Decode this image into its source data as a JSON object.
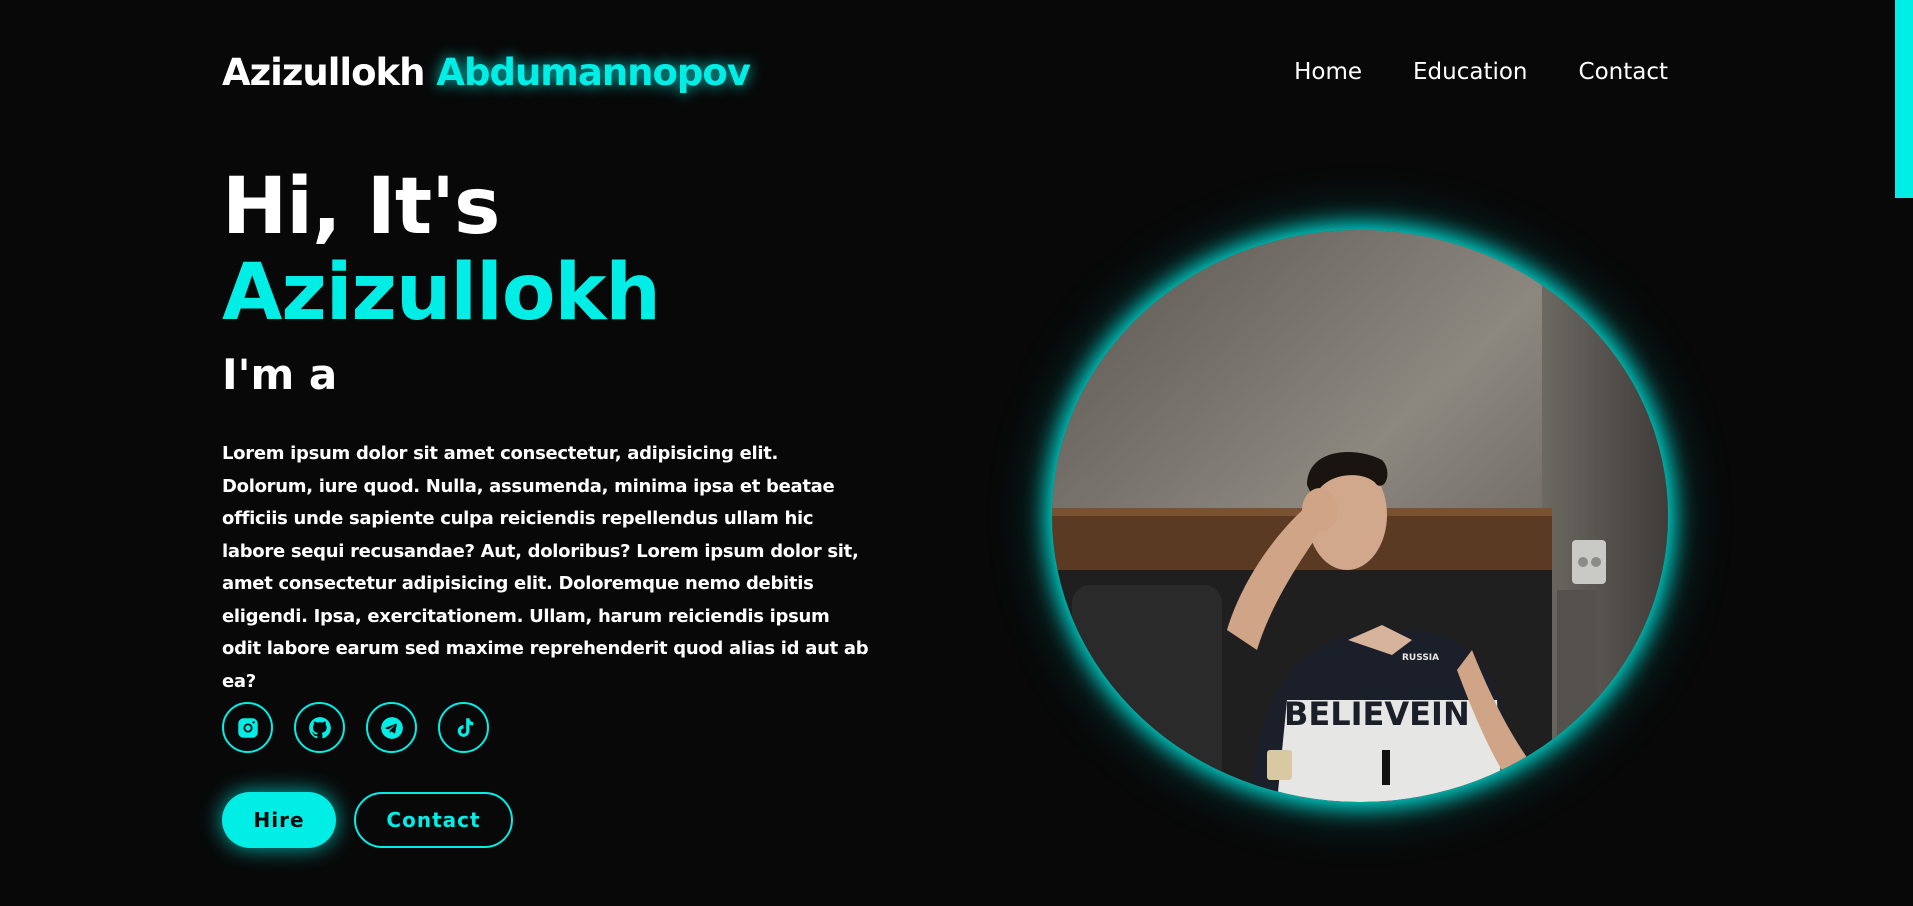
{
  "brand": {
    "first": "Azizullokh",
    "last": "Abdumannopov"
  },
  "nav": [
    {
      "label": "Home"
    },
    {
      "label": "Education"
    },
    {
      "label": "Contact"
    }
  ],
  "hero": {
    "greeting": "Hi, It's",
    "name": "Azizullokh",
    "role_prefix": "I'm a",
    "description": "Lorem ipsum dolor sit amet consectetur, adipisicing elit. Dolorum, iure quod. Nulla, assumenda, minima ipsa et beatae officiis unde sapiente culpa reiciendis repellendus ullam hic labore sequi recusandae? Aut, doloribus? Lorem ipsum dolor sit, amet consectetur adipisicing elit. Doloremque nemo debitis eligendi. Ipsa, exercitationem. Ullam, harum reiciendis ipsum odit labore earum sed maxime reprehenderit quod alias id aut ab ea?"
  },
  "socials": [
    {
      "icon": "instagram-icon"
    },
    {
      "icon": "github-icon"
    },
    {
      "icon": "telegram-icon"
    },
    {
      "icon": "tiktok-icon"
    }
  ],
  "buttons": {
    "hire": "Hire",
    "contact": "Contact"
  },
  "photo": {
    "shirt_text": "BELIEVEIN",
    "shirt_badge": "RUSSIA"
  },
  "colors": {
    "accent": "#00eee6",
    "background": "#080808",
    "text": "#ffffff"
  }
}
